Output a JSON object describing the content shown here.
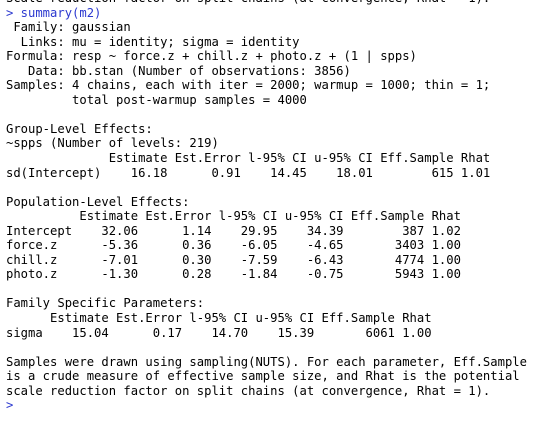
{
  "console": {
    "lines": [
      {
        "text": "Scale reduction factor on split chains (at convergence, Rhat = 1).",
        "kind": "out"
      },
      {
        "text": "> summary(m2)",
        "kind": "cmd"
      },
      {
        "text": " Family: gaussian",
        "kind": "out"
      },
      {
        "text": "  Links: mu = identity; sigma = identity",
        "kind": "out"
      },
      {
        "text": "Formula: resp ~ force.z + chill.z + photo.z + (1 | spps)",
        "kind": "out"
      },
      {
        "text": "   Data: bb.stan (Number of observations: 3856)",
        "kind": "out"
      },
      {
        "text": "Samples: 4 chains, each with iter = 2000; warmup = 1000; thin = 1;",
        "kind": "out"
      },
      {
        "text": "         total post-warmup samples = 4000",
        "kind": "out"
      },
      {
        "text": "",
        "kind": "out"
      },
      {
        "text": "Group-Level Effects:",
        "kind": "out"
      },
      {
        "text": "~spps (Number of levels: 219)",
        "kind": "out"
      },
      {
        "text": "              Estimate Est.Error l-95% CI u-95% CI Eff.Sample Rhat",
        "kind": "out"
      },
      {
        "text": "sd(Intercept)    16.18      0.91    14.45    18.01        615 1.01",
        "kind": "out"
      },
      {
        "text": "",
        "kind": "out"
      },
      {
        "text": "Population-Level Effects:",
        "kind": "out"
      },
      {
        "text": "          Estimate Est.Error l-95% CI u-95% CI Eff.Sample Rhat",
        "kind": "out"
      },
      {
        "text": "Intercept    32.06      1.14    29.95    34.39        387 1.02",
        "kind": "out"
      },
      {
        "text": "force.z      -5.36      0.36    -6.05    -4.65       3403 1.00",
        "kind": "out"
      },
      {
        "text": "chill.z      -7.01      0.30    -7.59    -6.43       4774 1.00",
        "kind": "out"
      },
      {
        "text": "photo.z      -1.30      0.28    -1.84    -0.75       5943 1.00",
        "kind": "out"
      },
      {
        "text": "",
        "kind": "out"
      },
      {
        "text": "Family Specific Parameters:",
        "kind": "out"
      },
      {
        "text": "      Estimate Est.Error l-95% CI u-95% CI Eff.Sample Rhat",
        "kind": "out"
      },
      {
        "text": "sigma    15.04      0.17    14.70    15.39       6061 1.00",
        "kind": "out"
      },
      {
        "text": "",
        "kind": "out"
      },
      {
        "text": "Samples were drawn using sampling(NUTS). For each parameter, Eff.Sample",
        "kind": "out"
      },
      {
        "text": "is a crude measure of effective sample size, and Rhat is the potential",
        "kind": "out"
      },
      {
        "text": "scale reduction factor on split chains (at convergence, Rhat = 1).",
        "kind": "out"
      },
      {
        "text": ">",
        "kind": "prompt"
      }
    ]
  },
  "colors": {
    "command": "#2c39d0",
    "output": "#000000",
    "background": "#ffffff"
  }
}
